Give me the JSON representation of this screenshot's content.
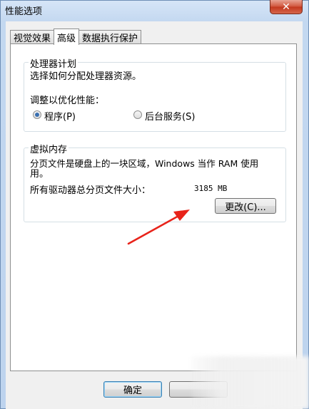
{
  "window": {
    "title": "性能选项",
    "close_symbol": "✕"
  },
  "tabs": [
    {
      "label": "视觉效果",
      "active": false
    },
    {
      "label": "高级",
      "active": true
    },
    {
      "label": "数据执行保护",
      "active": false
    }
  ],
  "processor": {
    "title": "处理器计划",
    "description": "选择如何分配处理器资源。",
    "adjust_label": "调整以优化性能：",
    "options": [
      {
        "label": "程序(P)",
        "checked": true
      },
      {
        "label": "后台服务(S)",
        "checked": false
      }
    ]
  },
  "virtual_memory": {
    "title": "虚拟内存",
    "description_line1": "分页文件是硬盘上的一块区域，Windows 当作 RAM 使用",
    "description_line2": "用。",
    "total_label": "所有驱动器总分页文件大小：",
    "total_value": "3185 MB",
    "change_button": "更改(C)..."
  },
  "footer": {
    "ok_button": "确定"
  },
  "colors": {
    "annotation_arrow": "#e8231a",
    "radio_dot": "#3a6fb0"
  }
}
